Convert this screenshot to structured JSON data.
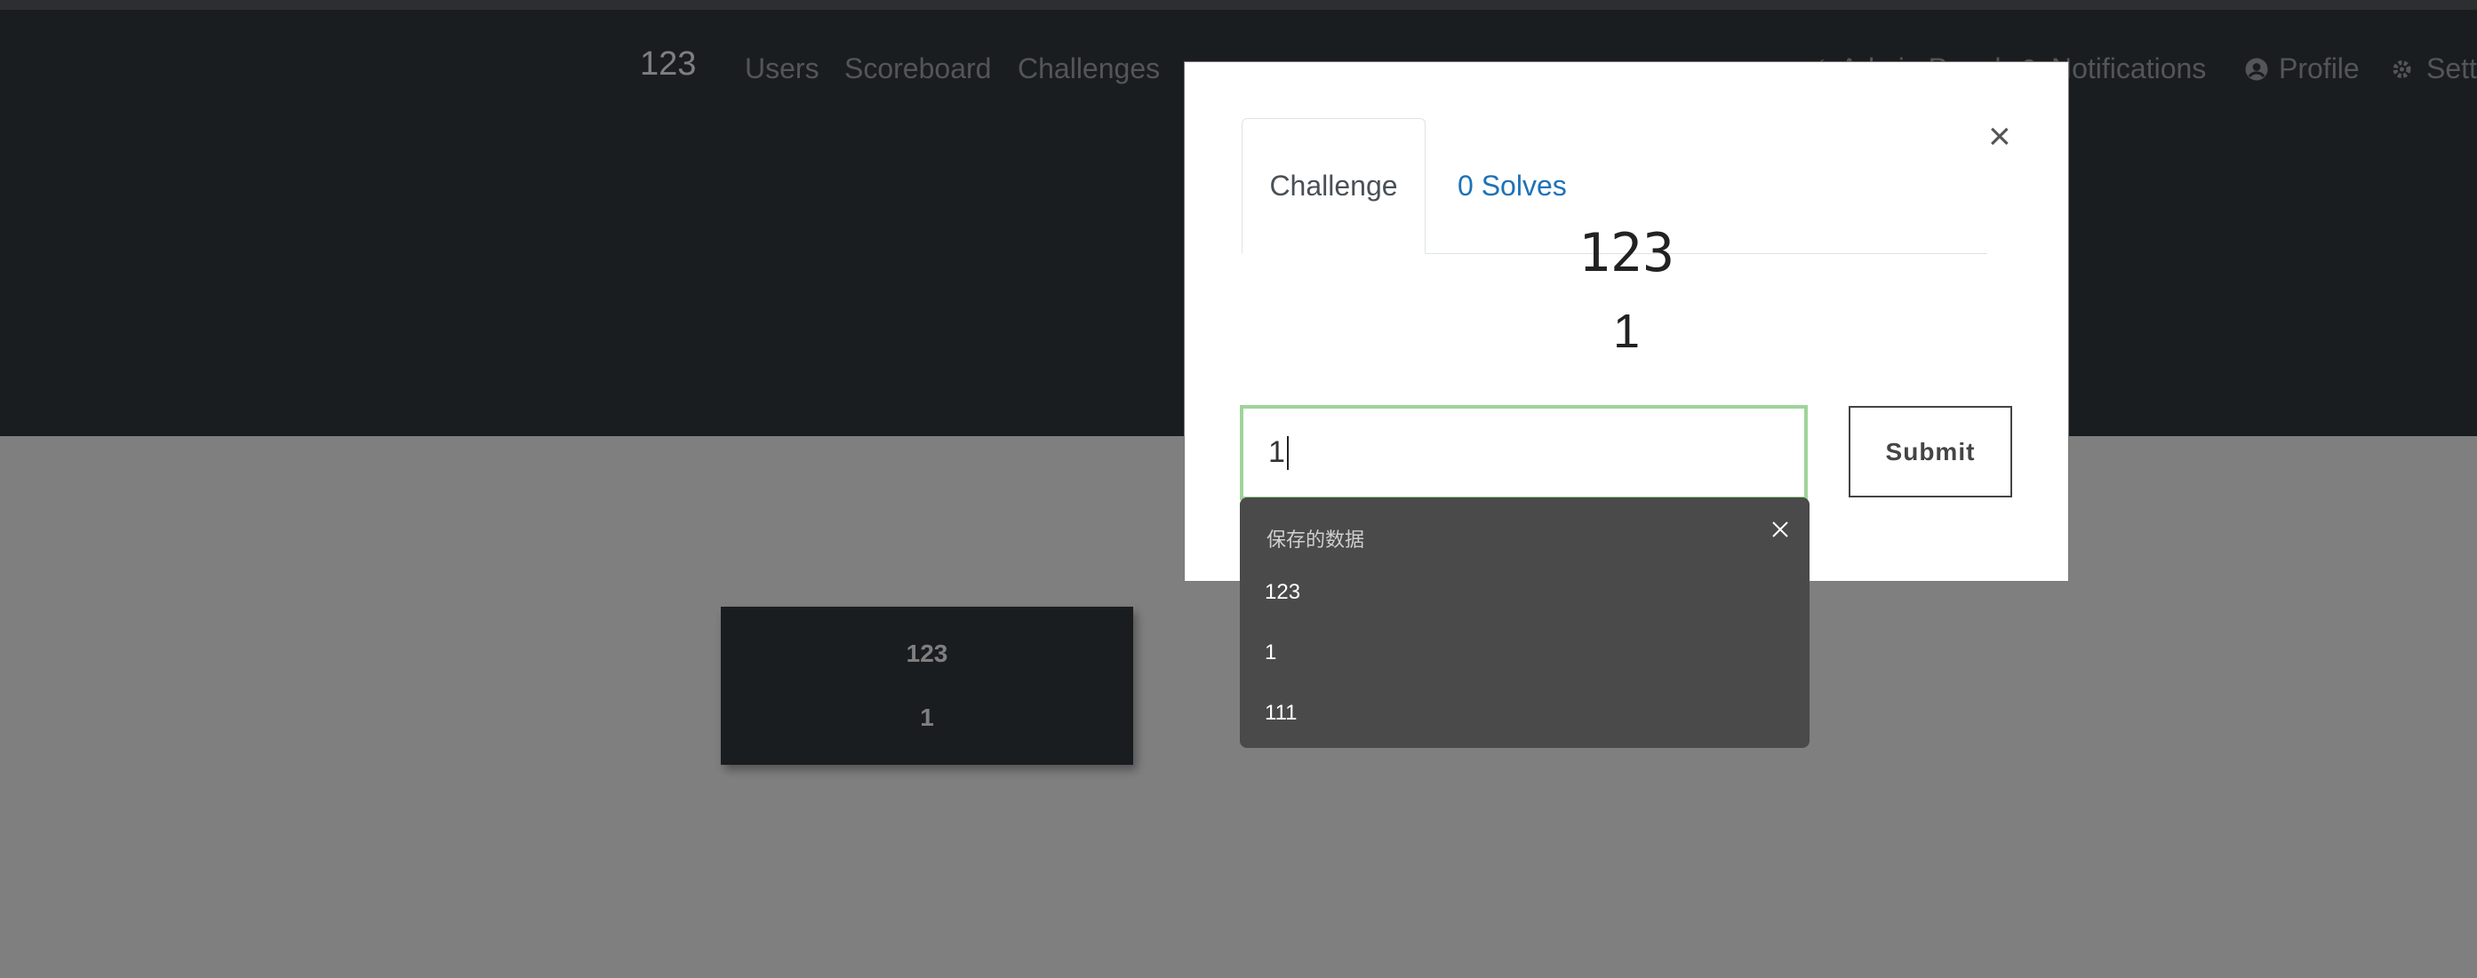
{
  "navbar": {
    "brand": "123",
    "links": [
      "Users",
      "Scoreboard",
      "Challenges"
    ],
    "right_links": [
      "Admin Panel",
      "Notifications",
      "Profile",
      "Settings"
    ]
  },
  "challenge_card": {
    "name": "123",
    "value": "1"
  },
  "modal": {
    "tabs": {
      "active": "Challenge",
      "solves": "0 Solves"
    },
    "close_symbol": "×",
    "title": "123",
    "points": "1",
    "flag_input_value": "1",
    "submit_label": "Submit"
  },
  "autofill": {
    "header": "保存的数据",
    "items": [
      "123",
      "1",
      "111"
    ]
  },
  "colors": {
    "navbar": "#343a40",
    "input_focus_border": "#9fd49a",
    "solves_link": "#1d72b8"
  }
}
